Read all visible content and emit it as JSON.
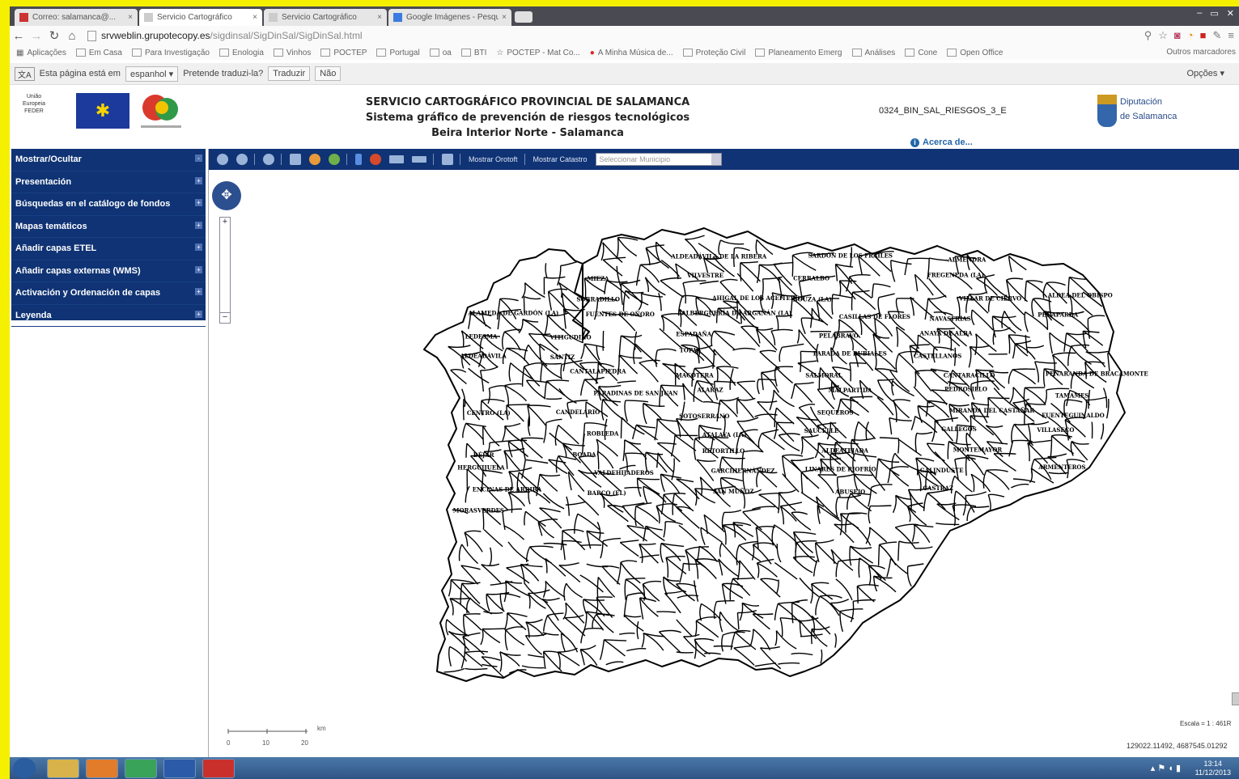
{
  "browser": {
    "tabs": [
      {
        "label": "Correo: salamanca@..."
      },
      {
        "label": "Servicio Cartográfico"
      },
      {
        "label": "Servicio Cartográfico"
      },
      {
        "label": "Google Imágenes - Pesqu..."
      }
    ],
    "url_domain": "srvweblin.grupotecopy.es",
    "url_path": "/sigdinsal/SigDinSal/SigDinSal.html",
    "bookmarks": [
      "Aplicações",
      "Em Casa",
      "Para Investigação",
      "Enologia",
      "Vinhos",
      "POCTEP",
      "Portugal",
      "oa",
      "BTI",
      "POCTEP - Mat Co...",
      "A Minha Música de...",
      "Proteção Civil",
      "Planeamento Emerg",
      "Análises",
      "Cone",
      "Open Office"
    ],
    "bookmarks_other": "Outros marcadores",
    "translate": {
      "text": "Esta página está em",
      "language": "espanhol",
      "question": "Pretende traduzi-la?",
      "translate_btn": "Traduzir",
      "no_btn": "Não",
      "options": "Opções"
    }
  },
  "header": {
    "feder_label": "União Europeia FEDER",
    "title1": "SERVICIO CARTOGRÁFICO PROVINCIAL DE SALAMANCA",
    "title2": "Sistema gráfico de prevención de riesgos tecnológicos",
    "title3": "Beira Interior Norte - Salamanca",
    "map_code": "0324_BIN_SAL_RIESGOS_3_E",
    "about": "Acerca de...",
    "dipu_line1": "Diputación",
    "dipu_line2": "de Salamanca"
  },
  "sidebar": {
    "items": [
      {
        "label": "Mostrar/Ocultar"
      },
      {
        "label": "Presentación"
      },
      {
        "label": "Búsquedas en el catálogo de fondos"
      },
      {
        "label": "Mapas temáticos"
      },
      {
        "label": "Añadir capas ETEL"
      },
      {
        "label": "Añadir capas externas (WMS)"
      },
      {
        "label": "Activación y Ordenación de capas"
      },
      {
        "label": "Leyenda"
      }
    ]
  },
  "toolbar": {
    "show_ortho": "Mostrar Orotoft",
    "show_cadastre": "Mostrar Catastro",
    "municipality_placeholder": "Seleccionar Municipio"
  },
  "map": {
    "scale_label": "Escala = 1 : 461R",
    "scale_ticks": [
      "0",
      "10",
      "20",
      "km"
    ],
    "coords": "129022.11492, 4687545.01292",
    "place_labels": [
      "ALDEADÁVILA DE LA RIBERA",
      "SARDÓN DE LOS FRAILES",
      "ALMENDRA",
      "MIEZA",
      "VILVESTRE",
      "CERRALBO",
      "FREGENEDA (LA)",
      "SOBRADILLO",
      "AHIGAL DE LOS ACEITEROS",
      "BOUZA (LA)",
      "VILLAR DE CIERVO",
      "ALDEA DEL OBISPO",
      "ALAMEDA DE GARDÓN (LA)",
      "FUENTES DE OÑORO",
      "ALBERGUERÍA DE ARGAÑÁN (LA)",
      "CASILLAS DE FLORES",
      "NAVASFRÍAS",
      "PEÑAPARDA",
      "LEDESMA",
      "VITIGUDINO",
      "ESPADAÑA",
      "PELABRAVO",
      "ANAYA DE ALBA",
      "ALDEADÁVILA",
      "SANTIZ",
      "TOPAS",
      "PARADA DE RUBIALES",
      "CASTELLANOS",
      "CANTALAPIEDRA",
      "MACOTERA",
      "SALMORAL",
      "CANTARACILLO",
      "PEÑARANDA DE BRACAMONTE",
      "PARADINAS DE SAN JUAN",
      "ALARAZ",
      "MALPARTIDA",
      "PEDROSILLO",
      "TAMAMES",
      "CENTRO (LA)",
      "CANDELARIO",
      "SOTOSERRANO",
      "SEQUEROS",
      "MIRANDA DEL CASTAÑAR",
      "FUENTEGUINALDO",
      "ROBLEDA",
      "ATALAYA (LA)",
      "SAUCELLE",
      "GALLEGOS",
      "VILLASECO",
      "BÉJAR",
      "BOADA",
      "RETORTILLO",
      "ALDEATEJADA",
      "MONTEMAYOR",
      "HERGUIJUELA",
      "VALDEHIJADEROS",
      "GARCIHERNÁNDEZ",
      "LINARES DE RIOFRÍO",
      "GALINDUSTE",
      "ARMENTEROS",
      "ENCINAS DE ARRIBA",
      "BARCO (EL)",
      "SAN MUÑOZ",
      "ABUSEJO",
      "CASTRAZ",
      "MORASVERDES"
    ]
  },
  "taskbar": {
    "time": "13:14",
    "date": "11/12/2013"
  }
}
